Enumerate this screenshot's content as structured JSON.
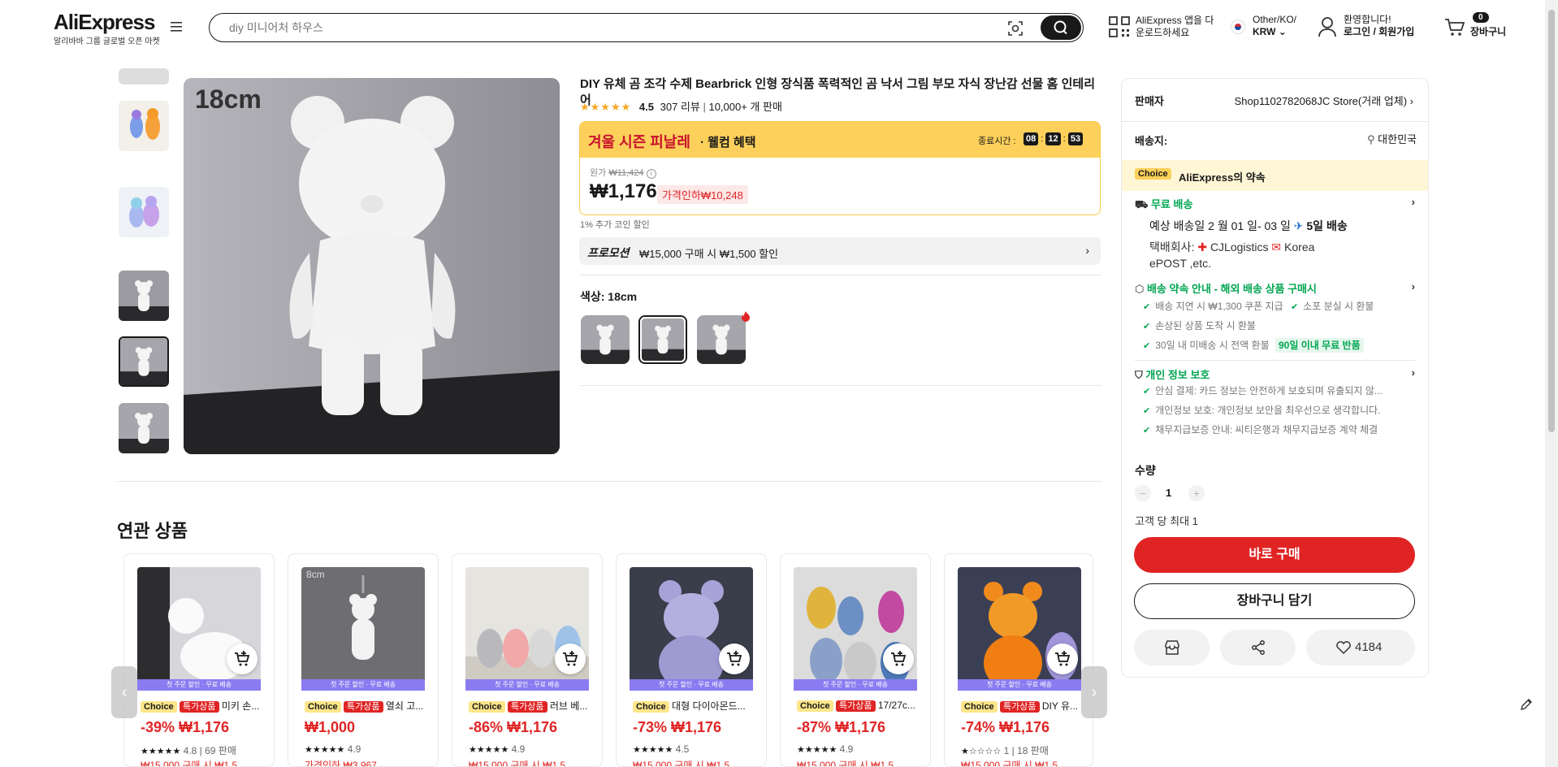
{
  "header": {
    "logo": "AliExpress",
    "logo_sub": "알리바바 그룹 글로벌 오픈 마켓",
    "search_placeholder": "diy 미니어처 하우스",
    "app_line1": "AliExpress 앱을 다",
    "app_line2": "운로드하세요",
    "region_line1": "Other/KO/",
    "region_line2": "KRW",
    "account_line1": "환영합니다!",
    "account_line2": "로그인 / 회원가입",
    "cart_count": "0",
    "cart_label": "장바구니"
  },
  "gallery": {
    "main_label": "18cm"
  },
  "product": {
    "title": "DIY 유체 곰 조각 수제 Bearbrick 인형 장식품 폭력적인 곰 낙서 그림 부모 자식 장난감 선물 홈 인테리어",
    "rating": "4.5",
    "reviews": "307 리뷰",
    "sold": "10,000+ 개 판매",
    "banner_title": "겨울 시즌 피날레",
    "banner_sub": "· 웰컴 혜택",
    "end_label": "종료시간 :",
    "timer": [
      "08",
      "12",
      "53"
    ],
    "original_label": "원가",
    "original_price": "₩11,424",
    "price": "₩1,176",
    "discount_badge": "가격인하₩10,248",
    "coin_note": "1% 추가 코인 할인",
    "promo_label": "프로모션",
    "promo_text": "₩15,000 구매 시 ₩1,500 할인",
    "color_label": "색상: 18cm"
  },
  "panel": {
    "seller_label": "판매자",
    "seller_name": "Shop1102782068JC Store(거래 업체)",
    "ship_to_label": "배송지:",
    "ship_to_value": "대한민국",
    "choice_badge": "Choice",
    "choice_text": "AliExpress의 약속",
    "free_ship": "무료 배송",
    "delivery_line": "예상 배송일 2 월 01 일- 03 일",
    "delivery_days": "5일 배송",
    "carrier_label": "택배회사:",
    "carrier_1": "CJLogistics",
    "carrier_2": "Korea",
    "carrier_3": "ePOST ,etc.",
    "promise_title": "배송 약속 안내 - 해외 배송 상품 구매시",
    "promise_1": "배송 지연 시 ₩1,300 쿠폰 지급",
    "promise_2": "소포 분실 시 환불",
    "promise_3": "손상된 상품 도착 시 환불",
    "promise_4": "30일 내 미배송 시 전액 환불",
    "promise_badge": "90일 이내 무료 반품",
    "privacy_title": "개인 정보 보호",
    "privacy_1": "안심 결제: 카드 정보는 안전하게 보호되며 유출되지 않...",
    "privacy_2": "개인정보 보호: 개인정보 보안을 최우선으로 생각합니다.",
    "privacy_3": "채무지급보증 안내: 씨티은행과 채무지급보증 계약 체결",
    "qty_label": "수량",
    "qty_minus": "−",
    "qty_value": "1",
    "qty_plus": "+",
    "qty_limit": "고객 당 최대 1",
    "buy_now": "바로 구매",
    "add_cart": "장바구니 담기",
    "wish_count": "4184"
  },
  "related": {
    "title": "연관 상품",
    "strip_text": "첫 주문 할인 · 무료 배송",
    "choice": "Choice",
    "special": "특가상품",
    "items": [
      {
        "name": "미키 손...",
        "price": "-39% ₩1,176",
        "rating": "4.8 | 69 판매",
        "promo": "₩15,000 구매 시 ₩1,5"
      },
      {
        "name": "열쇠 고...",
        "price": "₩1,000",
        "rating": "4.9",
        "promo": "가격인하 ₩3,967",
        "img_label": "8cm"
      },
      {
        "name": "러브 베...",
        "price": "-86% ₩1,176",
        "rating": "4.9",
        "promo": "₩15,000 구매 시 ₩1,5"
      },
      {
        "name": "대형 다이아몬드...",
        "price": "-73% ₩1,176",
        "rating": "4.5",
        "promo": "₩15,000 구매 시 ₩1,5"
      },
      {
        "name": "17/27c...",
        "price": "-87% ₩1,176",
        "rating": "4.9",
        "promo": "₩15,000 구매 시 ₩1,5"
      },
      {
        "name": "DIY 유...",
        "price": "-74% ₩1,176",
        "rating": "1 | 18 판매",
        "promo": "₩15,000 구매 시 ₩1,5"
      }
    ]
  },
  "colors": {
    "accent_red": "#e02424",
    "banner_yellow": "#fcd05a",
    "choice_yellow": "#fde68a",
    "green": "#00a651"
  }
}
